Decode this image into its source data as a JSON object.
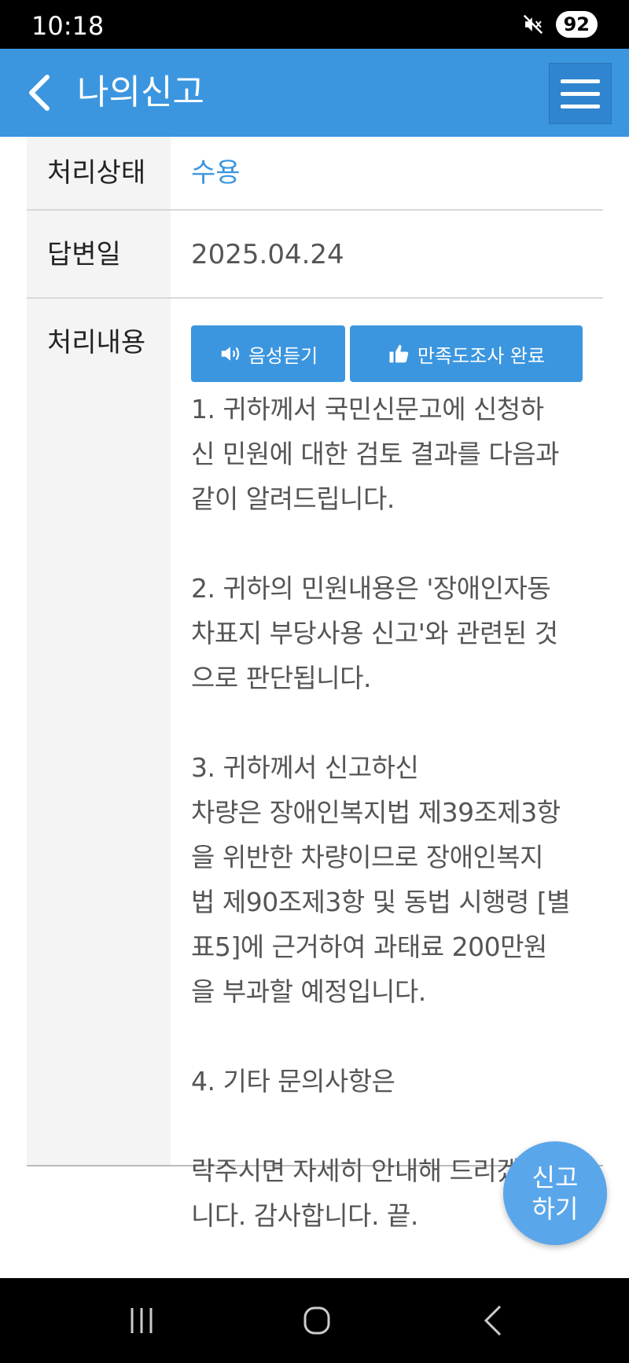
{
  "status_bar": {
    "time": "10:18",
    "battery": "92",
    "icons": [
      "mute-icon"
    ]
  },
  "header": {
    "title": "나의신고",
    "back_icon": "chevron-left-icon",
    "menu_icon": "hamburger-icon"
  },
  "details": {
    "status_label": "처리상태",
    "status_value": "수용",
    "date_label": "답변일",
    "date_value": "2025.04.24",
    "content_label": "처리내용"
  },
  "buttons": {
    "voice_label": "음성듣기",
    "survey_label": "만족도조사 완료"
  },
  "answer_text": "1. 귀하께서 국민신문고에 신청하\n신 민원에 대한 검토 결과를 다음과\n같이 알려드립니다.\n\n2. 귀하의 민원내용은 '장애인자동\n차표지 부당사용 신고'와 관련된 것\n으로 판단됩니다.\n\n3. 귀하께서 신고하신\n차량은 장애인복지법 제39조제3항\n을 위반한 차량이므로 장애인복지\n법 제90조제3항 및 동법 시행령 [별\n표5]에 근거하여 과태료 200만원\n을 부과할 예정입니다.\n\n4. 기타 문의사항은\n\n락주시면 자세히 안내해 드리겠습\n니다. 감사합니다. 끝.",
  "fab": {
    "label": "신고\n하기"
  },
  "colors": {
    "header_blue": "#3b96df",
    "status_blue": "#3b96df",
    "fab_blue": "#5aa6ea"
  }
}
